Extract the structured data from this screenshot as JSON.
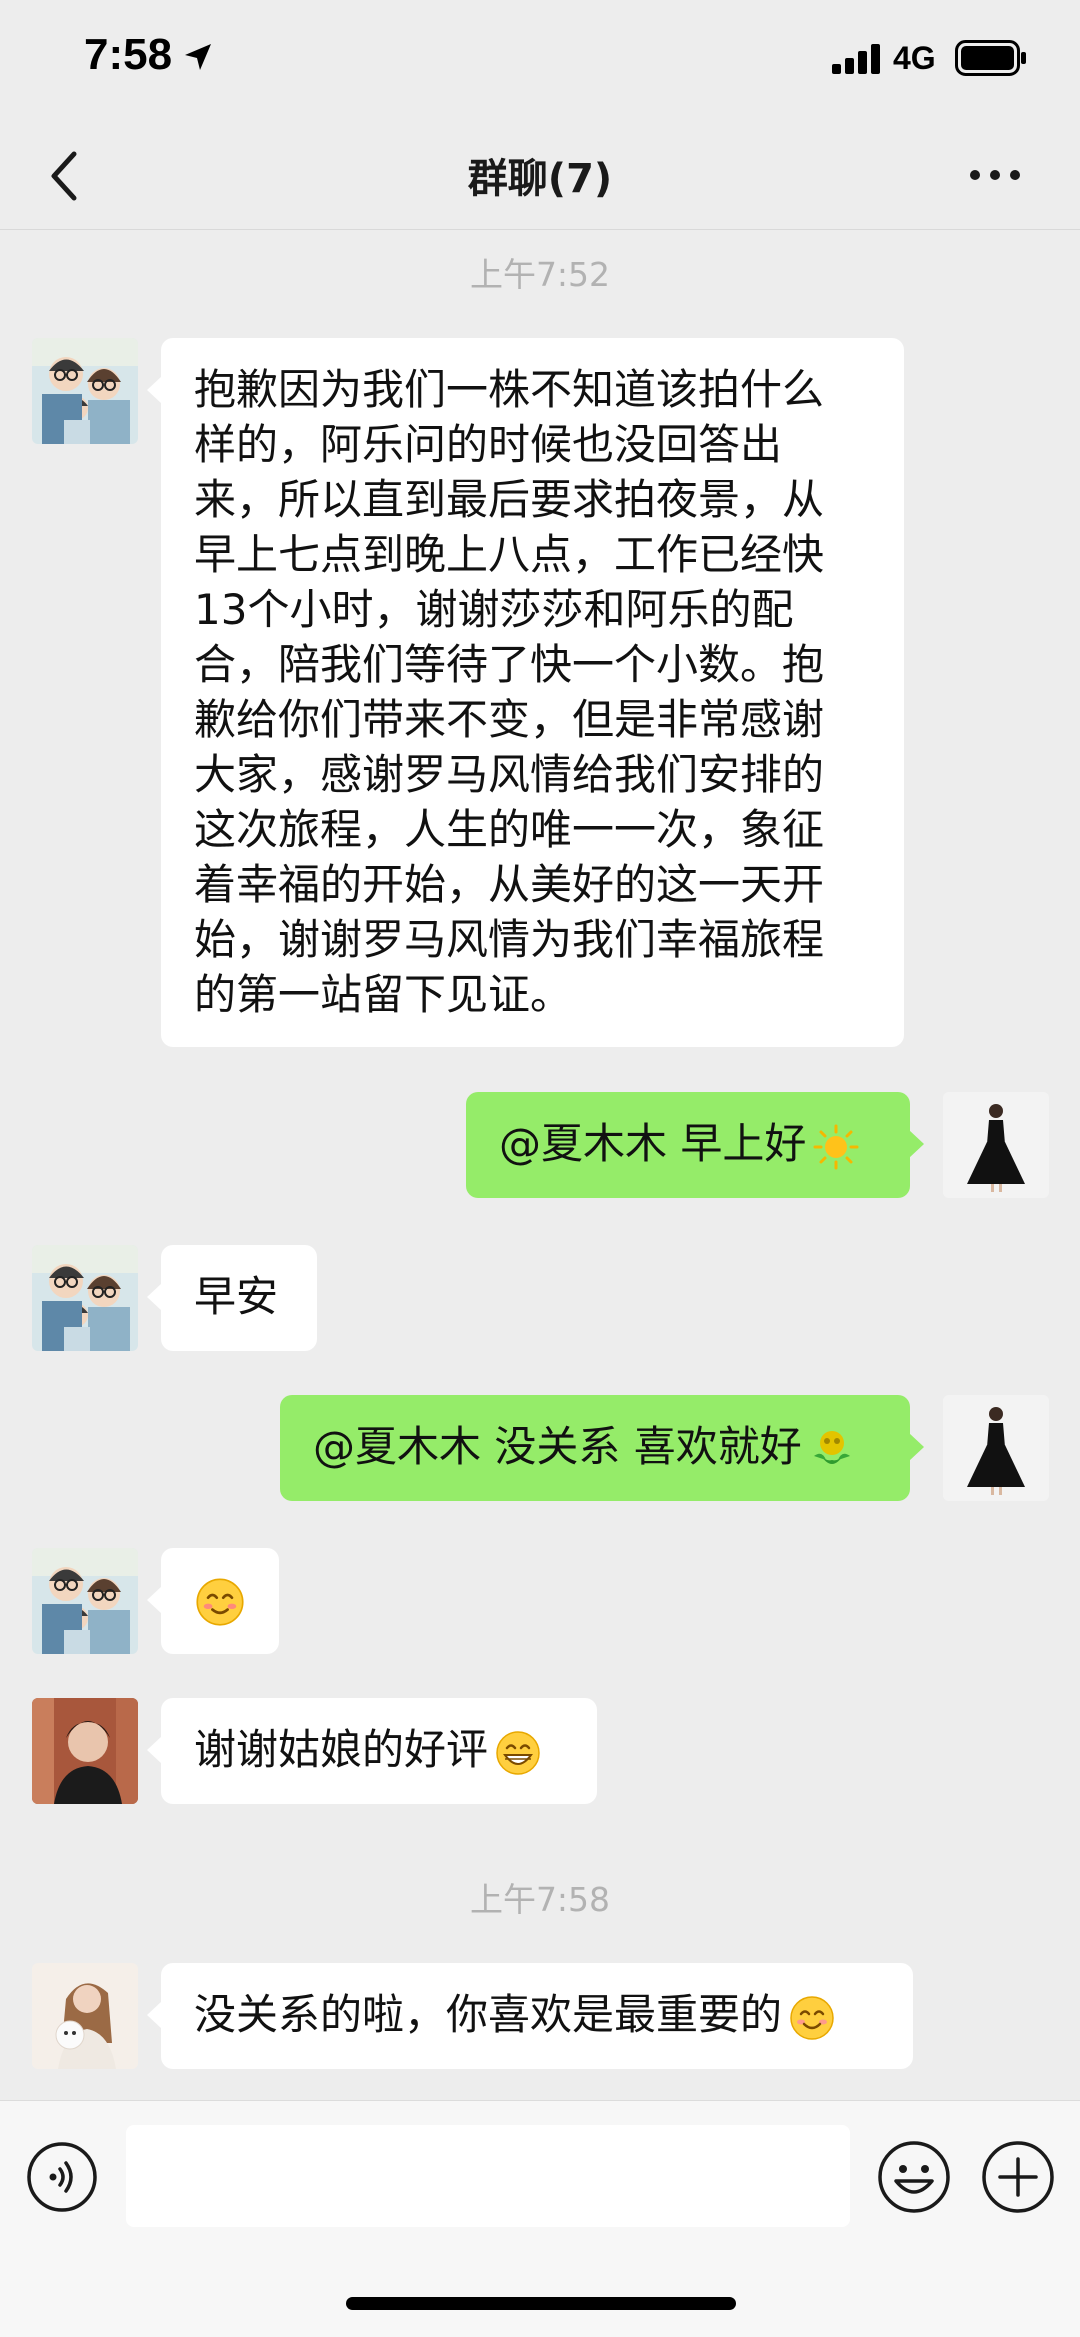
{
  "status_bar": {
    "time": "7:58",
    "network": "4G"
  },
  "header": {
    "title": "群聊(7)"
  },
  "timestamps": [
    "上午7:52",
    "上午7:58"
  ],
  "messages": [
    {
      "side": "in",
      "avatar": "cartoon-family-avatar",
      "text": "抱歉因为我们一株不知道该拍什么\n样的，阿乐问的时候也没回答出\n来，所以直到最后要求拍夜景，从\n早上七点到晚上八点，工作已经快\n13个小时，谢谢莎莎和阿乐的配\n合，陪我们等待了快一个小数。抱\n歉给你们带来不变，但是非常感谢\n大家，感谢罗马风情给我们安排的\n这次旅程，人生的唯一一次，象征\n着幸福的开始，从美好的这一天开\n始，谢谢罗马风情为我们幸福旅程\n的第一站留下见证。"
    },
    {
      "side": "out",
      "avatar": "black-dress-avatar",
      "text": "@夏木木 早上好",
      "emoji": "sun-icon"
    },
    {
      "side": "in",
      "avatar": "cartoon-family-avatar",
      "text": "早安"
    },
    {
      "side": "out",
      "avatar": "black-dress-avatar",
      "text": "@夏木木 没关系 喜欢就好",
      "emoji": "rose-icon"
    },
    {
      "side": "in",
      "avatar": "cartoon-family-avatar",
      "text": "",
      "emoji": "blush-smile-icon"
    },
    {
      "side": "in",
      "avatar": "man-portrait-avatar",
      "text": "谢谢姑娘的好评",
      "emoji": "grin-icon"
    },
    {
      "side": "in",
      "avatar": "woman-with-dog-avatar",
      "text": "没关系的啦，你喜欢是最重要的",
      "emoji": "smile-icon"
    }
  ],
  "input": {
    "placeholder": ""
  },
  "colors": {
    "background": "#ededed",
    "bubble_out": "#95ec69",
    "bubble_in": "#ffffff",
    "timestamp": "#b2b2b2"
  }
}
